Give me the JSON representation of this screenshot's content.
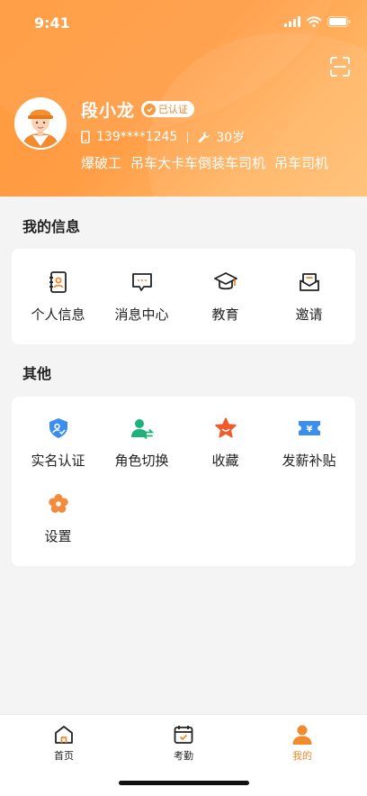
{
  "status_bar": {
    "time": "9:41"
  },
  "profile": {
    "name": "段小龙",
    "verified_label": "已认证",
    "phone": "139****1245",
    "age": "30岁",
    "tags": [
      "爆破工",
      "吊车大卡车倒装车司机",
      "吊车司机"
    ]
  },
  "my_info": {
    "title": "我的信息",
    "items": [
      {
        "label": "个人信息",
        "icon": "contact-card-icon"
      },
      {
        "label": "消息中心",
        "icon": "message-bubble-icon"
      },
      {
        "label": "教育",
        "icon": "graduation-cap-icon"
      },
      {
        "label": "邀请",
        "icon": "invitation-envelope-icon"
      }
    ]
  },
  "other": {
    "title": "其他",
    "items": [
      {
        "label": "实名认证",
        "icon": "shield-verify-icon",
        "color": "#3b8ef0"
      },
      {
        "label": "角色切换",
        "icon": "role-switch-icon",
        "color": "#1fb17a"
      },
      {
        "label": "收藏",
        "icon": "star-icon",
        "color": "#f25a2b"
      },
      {
        "label": "发薪补贴",
        "icon": "subsidy-ticket-icon",
        "color": "#3b8ef0"
      },
      {
        "label": "设置",
        "icon": "settings-flower-icon",
        "color": "#f58a3a"
      }
    ]
  },
  "tabbar": {
    "tabs": [
      {
        "label": "首页",
        "icon": "home-icon"
      },
      {
        "label": "考勤",
        "icon": "calendar-check-icon"
      },
      {
        "label": "我的",
        "icon": "person-icon",
        "active": true
      }
    ]
  },
  "colors": {
    "accent": "#f08a2c",
    "header_start": "#ff9a3c",
    "header_end": "#ffbf72"
  }
}
